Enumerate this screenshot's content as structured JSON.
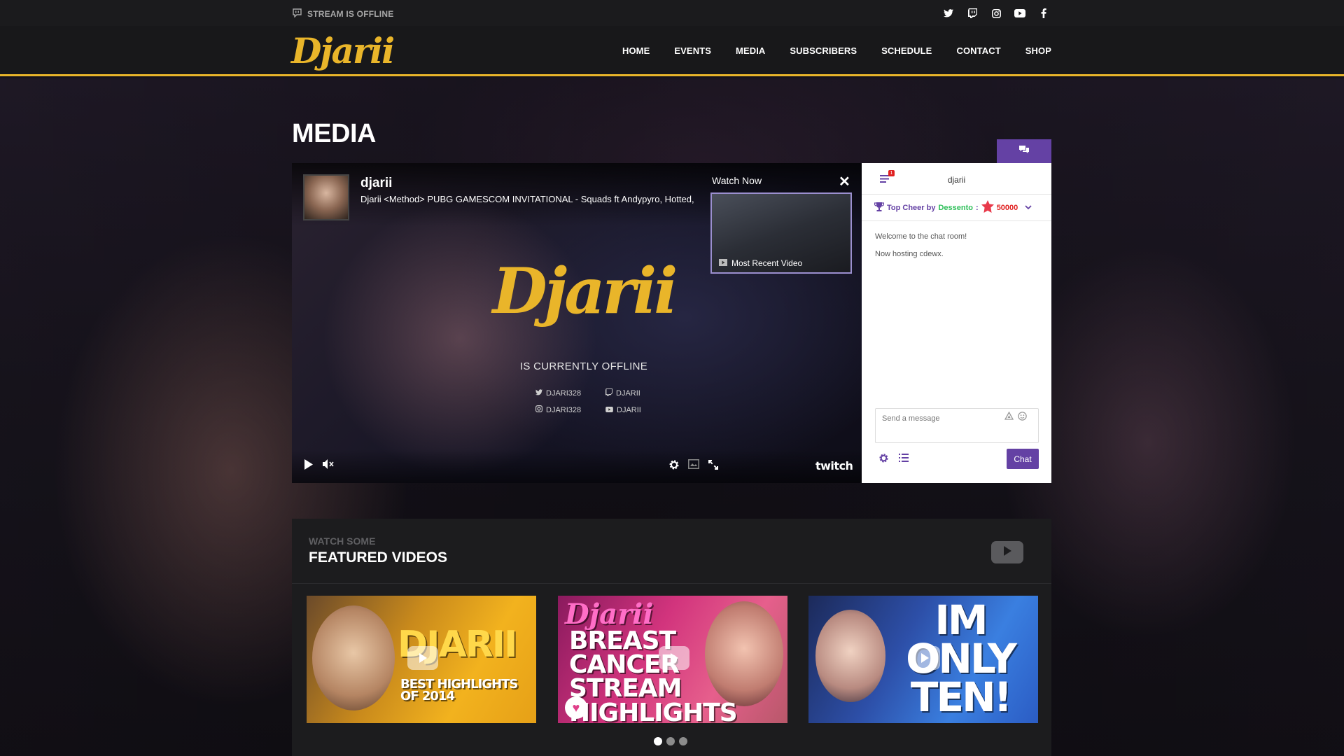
{
  "topbar": {
    "status_text": "STREAM IS OFFLINE",
    "social_icons": [
      "twitter-icon",
      "twitch-icon",
      "instagram-icon",
      "youtube-icon",
      "facebook-icon"
    ]
  },
  "nav": {
    "logo_text": "Djarii",
    "items": [
      "HOME",
      "EVENTS",
      "MEDIA",
      "SUBSCRIBERS",
      "SCHEDULE",
      "CONTACT",
      "SHOP"
    ]
  },
  "page": {
    "title": "MEDIA"
  },
  "player": {
    "channel_name": "djarii",
    "stream_title": "Djarii <Method> PUBG GAMESCOM INVITATIONAL - Squads ft Andypyro, Hotted,",
    "watch_now": "Watch Now",
    "recent_video_label": "Most Recent Video",
    "logo_text": "Djarii",
    "offline_text": "IS CURRENTLY OFFLINE",
    "socials": [
      {
        "icon": "twitter-icon",
        "label": "DJARI328"
      },
      {
        "icon": "twitch-icon",
        "label": "DJARII"
      },
      {
        "icon": "instagram-icon",
        "label": "DJARI328"
      },
      {
        "icon": "youtube-icon",
        "label": "DJARII"
      }
    ],
    "brand": "twitch"
  },
  "chat": {
    "room_name": "djarii",
    "notification_count": "1",
    "top_cheer_label": "Top Cheer by",
    "top_cheer_user": "Dessento",
    "top_cheer_amount": "50000",
    "messages": [
      "Welcome to the chat room!",
      "Now hosting cdewx."
    ],
    "input_placeholder": "Send a message",
    "send_label": "Chat"
  },
  "featured": {
    "subtitle": "WATCH SOME",
    "title": "FEATURED VIDEOS",
    "videos": [
      {
        "line1": "DJARII",
        "line2": "BEST HIGHLIGHTS OF 2014"
      },
      {
        "line1": "Djarii",
        "line2": "BREAST CANCER STREAM HIGHLIGHTS"
      },
      {
        "line1": "IM ONLY TEN!"
      }
    ],
    "carousel_pages": 3,
    "carousel_active": 1
  },
  "colors": {
    "accent": "#e9b52a",
    "twitch_purple": "#6441a4",
    "cheer_user": "#2fbf5a",
    "cheer_amount": "#e02020"
  }
}
